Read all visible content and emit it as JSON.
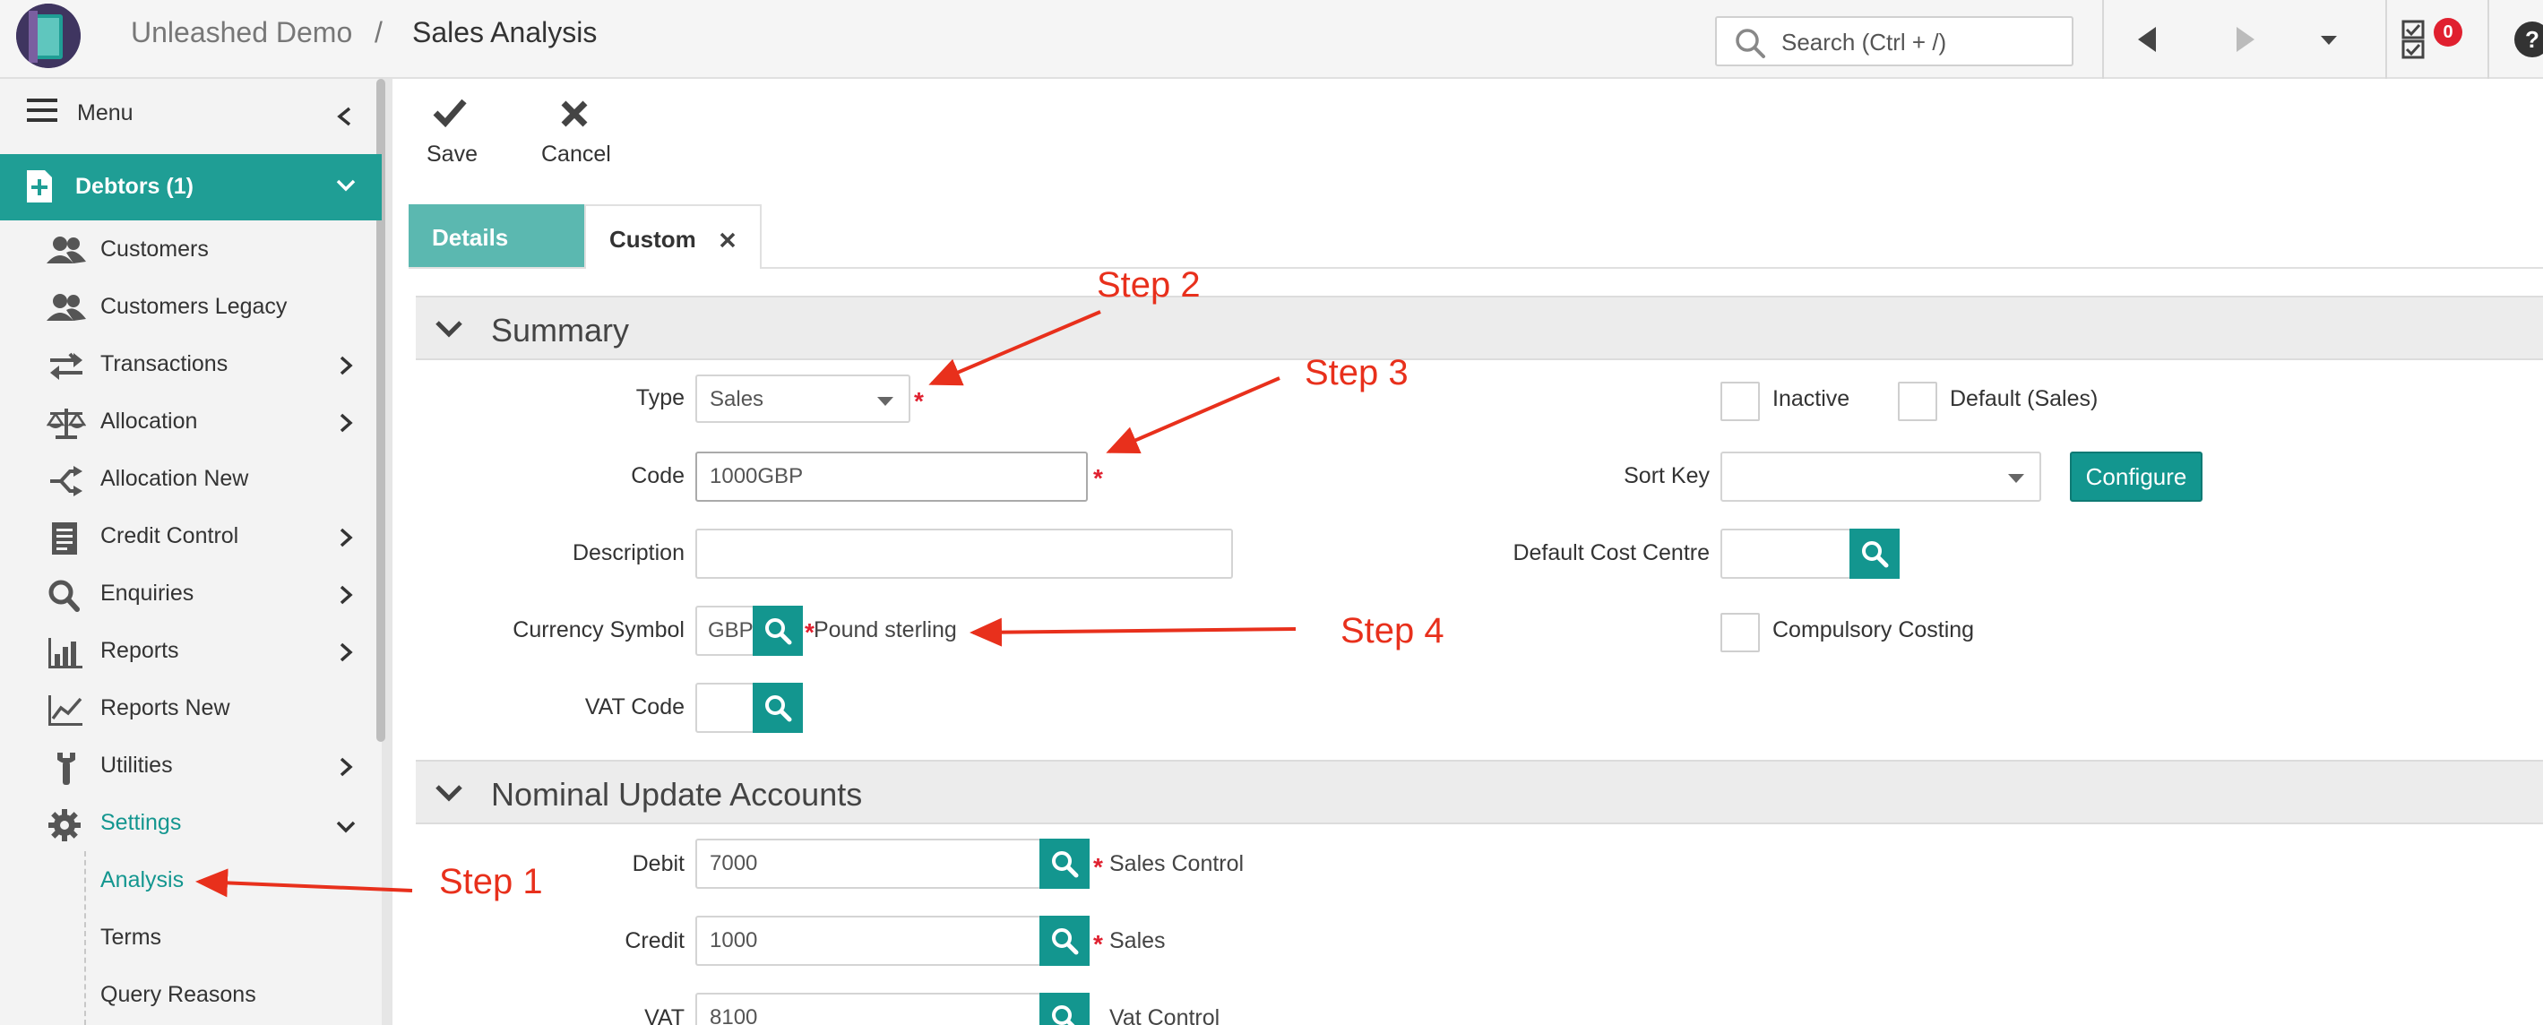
{
  "header": {
    "company": "Unleashed Demo",
    "separator": "/",
    "page": "Sales Analysis",
    "search_placeholder": "Search (Ctrl + /)",
    "notification_count": "0"
  },
  "sidebar": {
    "menu_label": "Menu",
    "section": "Debtors (1)",
    "items": [
      {
        "label": "Customers"
      },
      {
        "label": "Customers Legacy"
      },
      {
        "label": "Transactions"
      },
      {
        "label": "Allocation"
      },
      {
        "label": "Allocation New"
      },
      {
        "label": "Credit Control"
      },
      {
        "label": "Enquiries"
      },
      {
        "label": "Reports"
      },
      {
        "label": "Reports New"
      },
      {
        "label": "Utilities"
      },
      {
        "label": "Settings"
      }
    ],
    "sub_items": [
      {
        "label": "Analysis"
      },
      {
        "label": "Terms"
      },
      {
        "label": "Query Reasons"
      }
    ]
  },
  "toolbar": {
    "save_label": "Save",
    "cancel_label": "Cancel"
  },
  "tabs": {
    "details": "Details",
    "custom": "Custom"
  },
  "summary": {
    "title": "Summary",
    "type_label": "Type",
    "type_value": "Sales",
    "code_label": "Code",
    "code_value": "1000GBP",
    "description_label": "Description",
    "description_value": "",
    "currency_label": "Currency Symbol",
    "currency_value": "GBP",
    "currency_desc": "Pound sterling",
    "vat_label": "VAT Code",
    "inactive_label": "Inactive",
    "default_sales_label": "Default (Sales)",
    "sort_key_label": "Sort Key",
    "configure_label": "Configure",
    "cost_centre_label": "Default Cost Centre",
    "compulsory_label": "Compulsory Costing",
    "required_mark": "*"
  },
  "nominal": {
    "title": "Nominal Update Accounts",
    "debit_label": "Debit",
    "debit_value": "7000",
    "debit_desc": "Sales Control",
    "credit_label": "Credit",
    "credit_value": "1000",
    "credit_desc": "Sales",
    "vat_label": "VAT",
    "vat_value": "8100",
    "vat_desc": "Vat Control"
  },
  "annotations": {
    "step1": "Step 1",
    "step2": "Step 2",
    "step3": "Step 3",
    "step4": "Step 4"
  },
  "colors": {
    "accent": "#13968f",
    "sidebar_active": "#1f9e95",
    "tab_active": "#5bb8b0",
    "required": "#e0202f",
    "annotation": "#e8301c",
    "badge": "#e0202f"
  }
}
